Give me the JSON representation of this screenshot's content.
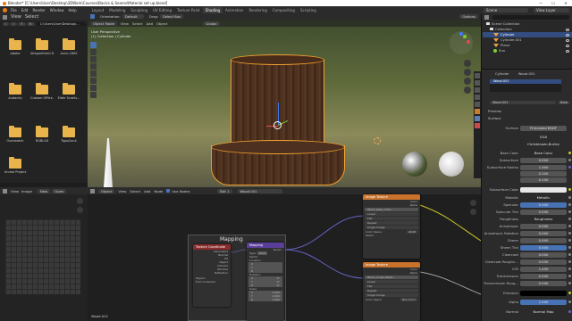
{
  "window": {
    "title": "Blender* [C:\\Users\\User\\Desktop\\3DWork\\Courses\\Basics & Seams\\Material set up.blend]",
    "minimize": "—",
    "maximize": "☐",
    "close": "✕"
  },
  "menu": [
    "File",
    "Edit",
    "Render",
    "Window",
    "Help"
  ],
  "workspaces": [
    "Layout",
    "Modeling",
    "Sculpting",
    "UV Editing",
    "Texture Paint",
    "Shading",
    "Animation",
    "Rendering",
    "Compositing",
    "Scripting"
  ],
  "active_workspace": "Shading",
  "topbar_right": {
    "scene": "Scene",
    "view_layer": "View Layer"
  },
  "file_browser": {
    "menu": [
      "View",
      "Select"
    ],
    "path": "C:\\Users\\User\\Desktop\\...",
    "items": [
      {
        "name": "Adobe"
      },
      {
        "name": "AllegorithmicTools"
      },
      {
        "name": "Anno 1800"
      },
      {
        "name": "Audacity"
      },
      {
        "name": "Custom Office..."
      },
      {
        "name": "Elder Scrolls..."
      },
      {
        "name": "Overwatch"
      },
      {
        "name": "ROBLOX"
      },
      {
        "name": "TopoGun4"
      },
      {
        "name": "Unreal Project"
      }
    ]
  },
  "viewport": {
    "header": {
      "mode": "Object Mode",
      "menus": [
        "View",
        "Select",
        "Add",
        "Object"
      ],
      "orientation": "Global",
      "options": "Options"
    },
    "info_line1": "User Perspective",
    "info_line2": "(1) Collection | Cylinder",
    "orientation_label": "Orientation:",
    "orientation_value": "Default",
    "drag_label": "Drag:",
    "drag_value": "Select Box"
  },
  "image_editor": {
    "menu": [
      "View",
      "Image"
    ],
    "new_label": "New",
    "open_label": "Open"
  },
  "node_editor": {
    "header": {
      "editor": "Object",
      "menus": [
        "View",
        "Select",
        "Add",
        "Node"
      ],
      "use_nodes": "Use Nodes",
      "slot": "Slot 1",
      "material": "Wood.001"
    },
    "frame_label": "Mapping",
    "material_label": "Wood.001",
    "nodes": {
      "texcoord": {
        "title": "Texture Coordinate",
        "rows": [
          "Generated",
          "Normal",
          "UV",
          "Object",
          "Camera",
          "Window",
          "Reflection",
          "Object:",
          "From Instancer"
        ]
      },
      "mapping": {
        "title": "Mapping",
        "rows": [
          "Vector",
          "Type:",
          "Point",
          "Vector",
          "Location",
          "X",
          "Y",
          "Z",
          "Rotation",
          "X",
          "Y",
          "Z",
          "Scale",
          "X",
          "Y",
          "Z"
        ],
        "rot_values": [
          "0°",
          "0°",
          "0°"
        ],
        "scale_values": [
          "1.000",
          "1.000",
          "1.000"
        ]
      },
      "image1": {
        "title": "Image Texture",
        "rows": [
          "Color",
          "Alpha",
          "Wood_base_color...",
          "Linear",
          "Flat",
          "Repeat",
          "Single Image",
          "Color Space",
          "sRGB",
          "Vector"
        ]
      },
      "image2": {
        "title": "Image Texture",
        "rows": [
          "Color",
          "Alpha",
          "Wood_rough_Metal...",
          "Linear",
          "Flat",
          "Repeat",
          "Single Image",
          "Color Space",
          "Non-Color"
        ]
      }
    }
  },
  "outliner": {
    "title": "Scene Collection",
    "rows": [
      {
        "name": "Collection",
        "level": 1
      },
      {
        "name": "Cylinder",
        "level": 2,
        "selected": true
      },
      {
        "name": "Cylinder.001",
        "level": 2
      },
      {
        "name": "Plane",
        "level": 2
      },
      {
        "name": "Sun",
        "level": 2
      }
    ]
  },
  "properties": {
    "object": "Cylinder",
    "material": "Wood.001",
    "slot_material": "Wood.001",
    "data_label": "Data",
    "preview_label": "Preview",
    "surface_section": "Surface",
    "surface_label": "Surface",
    "surface_value": "Principled BSDF",
    "distribution": "GGX",
    "subsurface_method": "Christensen-Burley",
    "rows": [
      {
        "label": "Base Color",
        "value": "Base Color"
      },
      {
        "label": "Subsurface",
        "value": "0.000"
      },
      {
        "label": "Subsurface Radius",
        "value": "1.000"
      },
      {
        "label": "",
        "value": "0.200"
      },
      {
        "label": "",
        "value": "0.100"
      },
      {
        "label": "Subsurface Color",
        "value": ""
      },
      {
        "label": "Metallic",
        "value": "Metallic"
      },
      {
        "label": "Specular",
        "value": "0.500",
        "blue": true
      },
      {
        "label": "Specular Tint",
        "value": "0.000"
      },
      {
        "label": "Roughness",
        "value": "Roughness"
      },
      {
        "label": "Anisotropic",
        "value": "0.000"
      },
      {
        "label": "Anisotropic Rotation",
        "value": "0.000"
      },
      {
        "label": "Sheen",
        "value": "0.000"
      },
      {
        "label": "Sheen Tint",
        "value": "0.500",
        "blue": true
      },
      {
        "label": "Clearcoat",
        "value": "0.000"
      },
      {
        "label": "Clearcoat Roughn...",
        "value": "0.030"
      },
      {
        "label": "IOR",
        "value": "1.450"
      },
      {
        "label": "Transmission",
        "value": "0.000"
      },
      {
        "label": "Transmission Roug...",
        "value": "0.000"
      },
      {
        "label": "Emission",
        "value": ""
      },
      {
        "label": "Alpha",
        "value": "1.000",
        "blue": true
      },
      {
        "label": "Normal",
        "value": "Normal Map"
      }
    ]
  }
}
